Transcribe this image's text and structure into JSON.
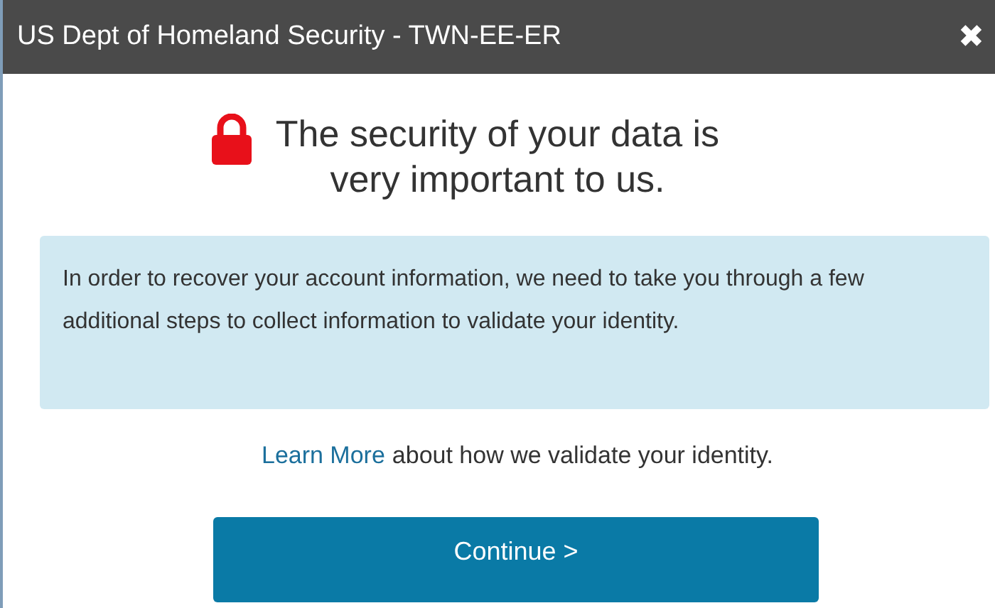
{
  "window": {
    "title": "US Dept of Homeland Security - TWN-EE-ER",
    "close": "✖"
  },
  "heading": "The security of your data is very important to us.",
  "notice": "In order to recover your account information, we need to take you through a few additional steps to collect information to validate your identity.",
  "learn_more": {
    "link": "Learn More",
    "text": "about how we validate your identity."
  },
  "continue_button": "Continue >"
}
